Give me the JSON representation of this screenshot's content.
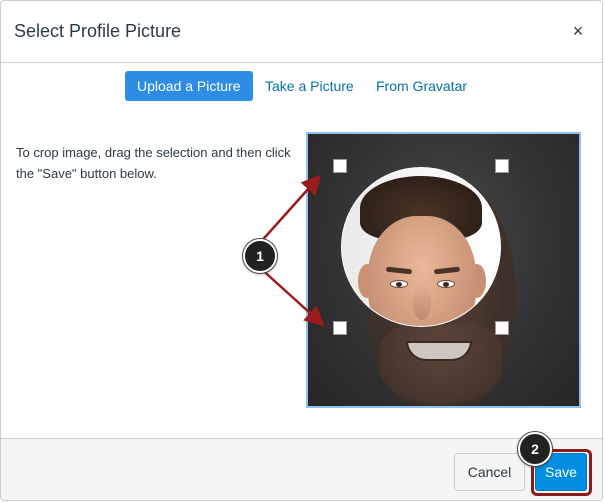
{
  "dialog": {
    "title": "Select Profile Picture",
    "close_symbol": "×"
  },
  "tabs": [
    {
      "label": "Upload a Picture",
      "active": true
    },
    {
      "label": "Take a Picture",
      "active": false
    },
    {
      "label": "From Gravatar",
      "active": false
    }
  ],
  "instructions": "To crop image, drag the selection and then click the \"Save\" button below.",
  "crop": {
    "handles_icon": "square-handle-icon",
    "selection_shape": "circle"
  },
  "callouts": {
    "one": "1",
    "two": "2"
  },
  "footer": {
    "cancel_label": "Cancel",
    "save_label": "Save"
  },
  "colors": {
    "accent": "#2d8ce3",
    "link": "#0770a3",
    "save": "#008ee2",
    "highlight": "#8b1a1a",
    "arrow": "#9b1c1c"
  }
}
